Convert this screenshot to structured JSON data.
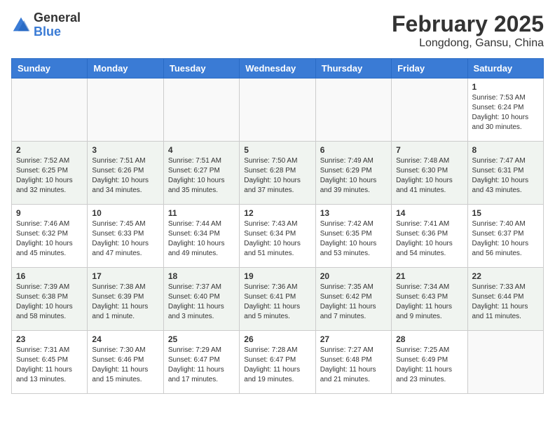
{
  "header": {
    "logo_general": "General",
    "logo_blue": "Blue",
    "title": "February 2025",
    "subtitle": "Longdong, Gansu, China"
  },
  "weekdays": [
    "Sunday",
    "Monday",
    "Tuesday",
    "Wednesday",
    "Thursday",
    "Friday",
    "Saturday"
  ],
  "weeks": [
    [
      {
        "day": "",
        "info": ""
      },
      {
        "day": "",
        "info": ""
      },
      {
        "day": "",
        "info": ""
      },
      {
        "day": "",
        "info": ""
      },
      {
        "day": "",
        "info": ""
      },
      {
        "day": "",
        "info": ""
      },
      {
        "day": "1",
        "info": "Sunrise: 7:53 AM\nSunset: 6:24 PM\nDaylight: 10 hours and 30 minutes."
      }
    ],
    [
      {
        "day": "2",
        "info": "Sunrise: 7:52 AM\nSunset: 6:25 PM\nDaylight: 10 hours and 32 minutes."
      },
      {
        "day": "3",
        "info": "Sunrise: 7:51 AM\nSunset: 6:26 PM\nDaylight: 10 hours and 34 minutes."
      },
      {
        "day": "4",
        "info": "Sunrise: 7:51 AM\nSunset: 6:27 PM\nDaylight: 10 hours and 35 minutes."
      },
      {
        "day": "5",
        "info": "Sunrise: 7:50 AM\nSunset: 6:28 PM\nDaylight: 10 hours and 37 minutes."
      },
      {
        "day": "6",
        "info": "Sunrise: 7:49 AM\nSunset: 6:29 PM\nDaylight: 10 hours and 39 minutes."
      },
      {
        "day": "7",
        "info": "Sunrise: 7:48 AM\nSunset: 6:30 PM\nDaylight: 10 hours and 41 minutes."
      },
      {
        "day": "8",
        "info": "Sunrise: 7:47 AM\nSunset: 6:31 PM\nDaylight: 10 hours and 43 minutes."
      }
    ],
    [
      {
        "day": "9",
        "info": "Sunrise: 7:46 AM\nSunset: 6:32 PM\nDaylight: 10 hours and 45 minutes."
      },
      {
        "day": "10",
        "info": "Sunrise: 7:45 AM\nSunset: 6:33 PM\nDaylight: 10 hours and 47 minutes."
      },
      {
        "day": "11",
        "info": "Sunrise: 7:44 AM\nSunset: 6:34 PM\nDaylight: 10 hours and 49 minutes."
      },
      {
        "day": "12",
        "info": "Sunrise: 7:43 AM\nSunset: 6:34 PM\nDaylight: 10 hours and 51 minutes."
      },
      {
        "day": "13",
        "info": "Sunrise: 7:42 AM\nSunset: 6:35 PM\nDaylight: 10 hours and 53 minutes."
      },
      {
        "day": "14",
        "info": "Sunrise: 7:41 AM\nSunset: 6:36 PM\nDaylight: 10 hours and 54 minutes."
      },
      {
        "day": "15",
        "info": "Sunrise: 7:40 AM\nSunset: 6:37 PM\nDaylight: 10 hours and 56 minutes."
      }
    ],
    [
      {
        "day": "16",
        "info": "Sunrise: 7:39 AM\nSunset: 6:38 PM\nDaylight: 10 hours and 58 minutes."
      },
      {
        "day": "17",
        "info": "Sunrise: 7:38 AM\nSunset: 6:39 PM\nDaylight: 11 hours and 1 minute."
      },
      {
        "day": "18",
        "info": "Sunrise: 7:37 AM\nSunset: 6:40 PM\nDaylight: 11 hours and 3 minutes."
      },
      {
        "day": "19",
        "info": "Sunrise: 7:36 AM\nSunset: 6:41 PM\nDaylight: 11 hours and 5 minutes."
      },
      {
        "day": "20",
        "info": "Sunrise: 7:35 AM\nSunset: 6:42 PM\nDaylight: 11 hours and 7 minutes."
      },
      {
        "day": "21",
        "info": "Sunrise: 7:34 AM\nSunset: 6:43 PM\nDaylight: 11 hours and 9 minutes."
      },
      {
        "day": "22",
        "info": "Sunrise: 7:33 AM\nSunset: 6:44 PM\nDaylight: 11 hours and 11 minutes."
      }
    ],
    [
      {
        "day": "23",
        "info": "Sunrise: 7:31 AM\nSunset: 6:45 PM\nDaylight: 11 hours and 13 minutes."
      },
      {
        "day": "24",
        "info": "Sunrise: 7:30 AM\nSunset: 6:46 PM\nDaylight: 11 hours and 15 minutes."
      },
      {
        "day": "25",
        "info": "Sunrise: 7:29 AM\nSunset: 6:47 PM\nDaylight: 11 hours and 17 minutes."
      },
      {
        "day": "26",
        "info": "Sunrise: 7:28 AM\nSunset: 6:47 PM\nDaylight: 11 hours and 19 minutes."
      },
      {
        "day": "27",
        "info": "Sunrise: 7:27 AM\nSunset: 6:48 PM\nDaylight: 11 hours and 21 minutes."
      },
      {
        "day": "28",
        "info": "Sunrise: 7:25 AM\nSunset: 6:49 PM\nDaylight: 11 hours and 23 minutes."
      },
      {
        "day": "",
        "info": ""
      }
    ]
  ]
}
